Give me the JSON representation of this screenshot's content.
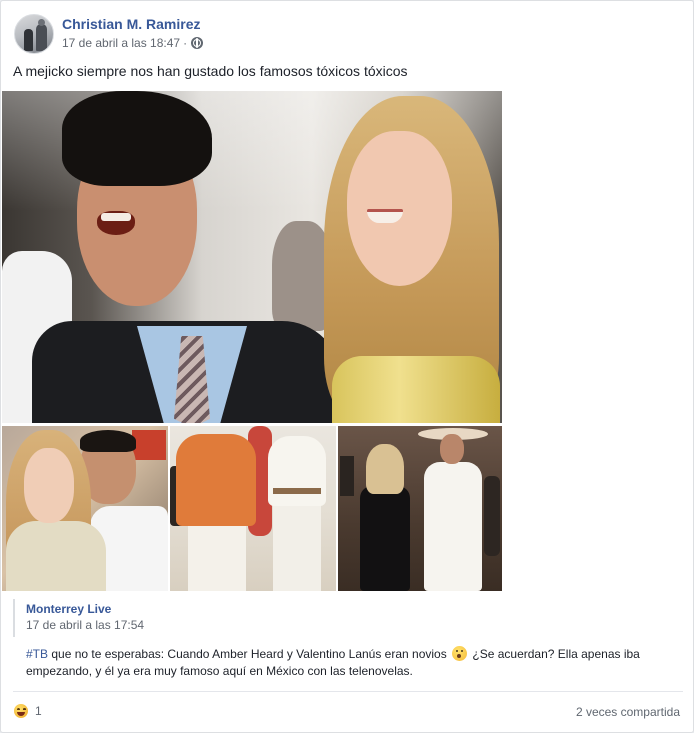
{
  "post": {
    "author": "Christian M. Ramirez",
    "timestamp": "17 de abril a las 18:47",
    "separator": "·",
    "privacy_icon": "globe-icon",
    "caption": "A mejicko siempre nos han gustado los famosos tóxicos tóxicos"
  },
  "shared": {
    "page_name": "Monterrey Live",
    "timestamp": "17 de abril a las 17:54",
    "hashtag": "#TB",
    "text_part1": " que no te esperabas: Cuando Amber Heard y Valentino Lanús eran novios ",
    "emoji_icon": "hushed-face-emoji",
    "text_part2": " ¿Se acuerdan? Ella apenas iba empezando, y él ya era muy famoso aquí en México con las telenovelas."
  },
  "footer": {
    "reaction_icon": "haha-reaction-icon",
    "reaction_count": "1",
    "shares": "2 veces compartida"
  },
  "colors": {
    "link_blue": "#385898",
    "meta_gray": "#616770",
    "border": "#dddfe2"
  }
}
